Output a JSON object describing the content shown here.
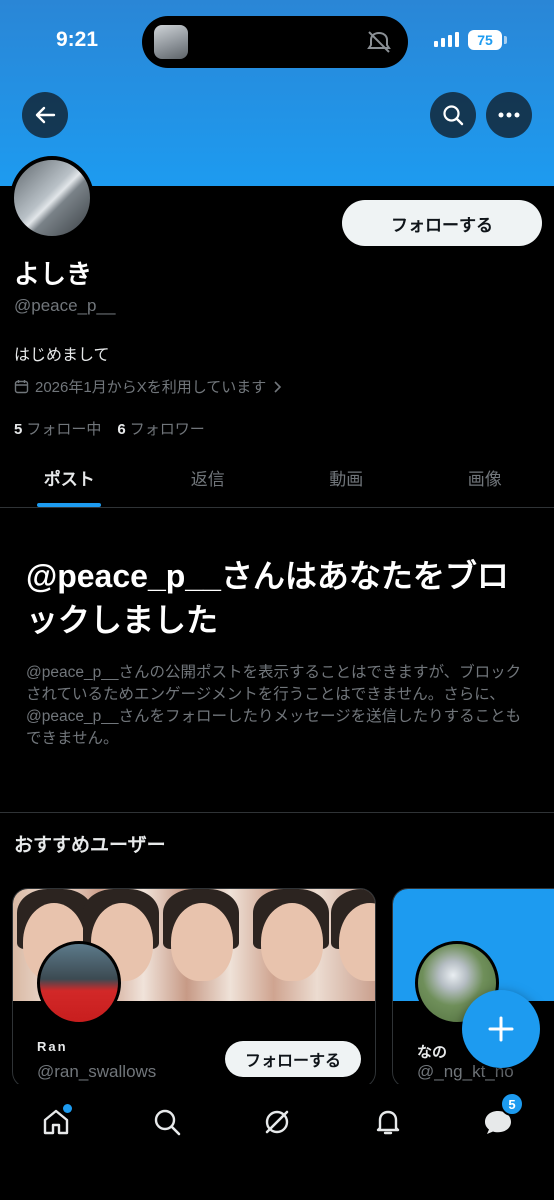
{
  "status_bar": {
    "time": "9:21",
    "battery": "75"
  },
  "profile": {
    "name": "よしき",
    "handle": "@peace_p__",
    "bio": "はじめまして",
    "joined": "2026年1月からXを利用しています",
    "following_count": "5",
    "following_label": "フォロー中",
    "followers_count": "6",
    "followers_label": "フォロワー",
    "follow_label": "フォローする"
  },
  "tabs": [
    {
      "label": "ポスト",
      "active": true
    },
    {
      "label": "返信",
      "active": false
    },
    {
      "label": "動画",
      "active": false
    },
    {
      "label": "画像",
      "active": false
    }
  ],
  "blocked": {
    "title": "@peace_p__さんはあなたをブロックしました",
    "body": "@peace_p__さんの公開ポストを表示することはできますが、ブロックされているためエンゲージメントを行うことはできません。さらに、@peace_p__さんをフォローしたりメッセージを送信したりすることもできません。"
  },
  "suggestions": {
    "title": "おすすめユーザー",
    "users": [
      {
        "name": "Ran",
        "handle": "@ran_swallows",
        "follow_label": "フォローする"
      },
      {
        "name": "なの",
        "handle": "@_ng_kt_no"
      }
    ]
  },
  "bottom_nav": {
    "messages_badge": "5"
  },
  "colors": {
    "accent": "#1d9bf0",
    "background": "#000000",
    "muted": "#71767b"
  },
  "icons": [
    "back-arrow-icon",
    "search-icon",
    "more-icon",
    "calendar-icon",
    "chevron-right-icon",
    "plus-icon",
    "home-icon",
    "explore-icon",
    "grok-icon",
    "bell-icon",
    "messages-icon"
  ]
}
